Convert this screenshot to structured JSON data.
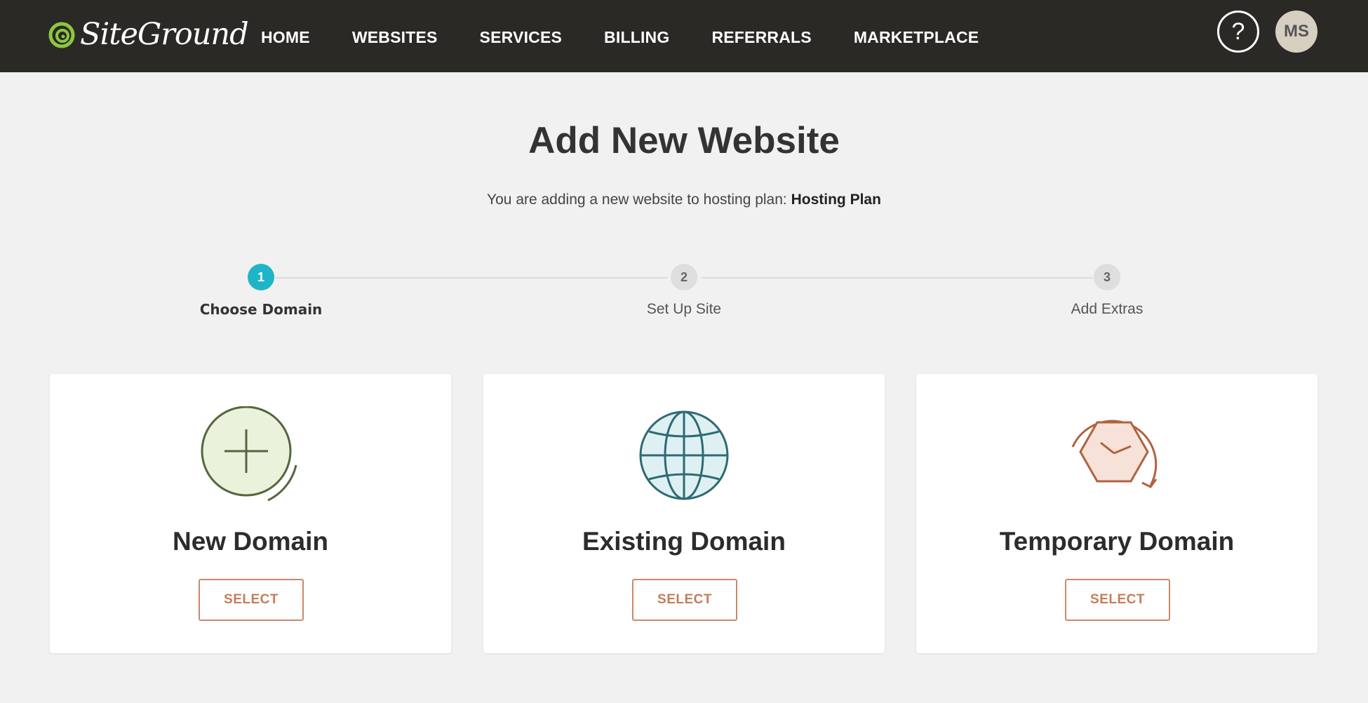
{
  "header": {
    "logo_text": "SiteGround",
    "nav": [
      "HOME",
      "WEBSITES",
      "SERVICES",
      "BILLING",
      "REFERRALS",
      "MARKETPLACE"
    ],
    "help_icon": "question-mark-icon",
    "avatar_initials": "MS"
  },
  "main": {
    "title": "Add New Website",
    "subtitle_prefix": "You are adding a new website to hosting plan:",
    "subtitle_plan": "Hosting Plan"
  },
  "stepper": {
    "steps": [
      {
        "number": "1",
        "label": "Choose Domain",
        "active": true
      },
      {
        "number": "2",
        "label": "Set Up Site",
        "active": false
      },
      {
        "number": "3",
        "label": "Add Extras",
        "active": false
      }
    ]
  },
  "cards": [
    {
      "title": "New Domain",
      "button": "SELECT",
      "icon": "plus-circle-icon"
    },
    {
      "title": "Existing Domain",
      "button": "SELECT",
      "icon": "globe-icon"
    },
    {
      "title": "Temporary Domain",
      "button": "SELECT",
      "icon": "clock-hexagon-icon"
    }
  ],
  "colors": {
    "header_bg": "#2b2926",
    "step_active": "#1fb5c9",
    "button_accent": "#c98a6a",
    "page_bg": "#f1f1f1"
  }
}
